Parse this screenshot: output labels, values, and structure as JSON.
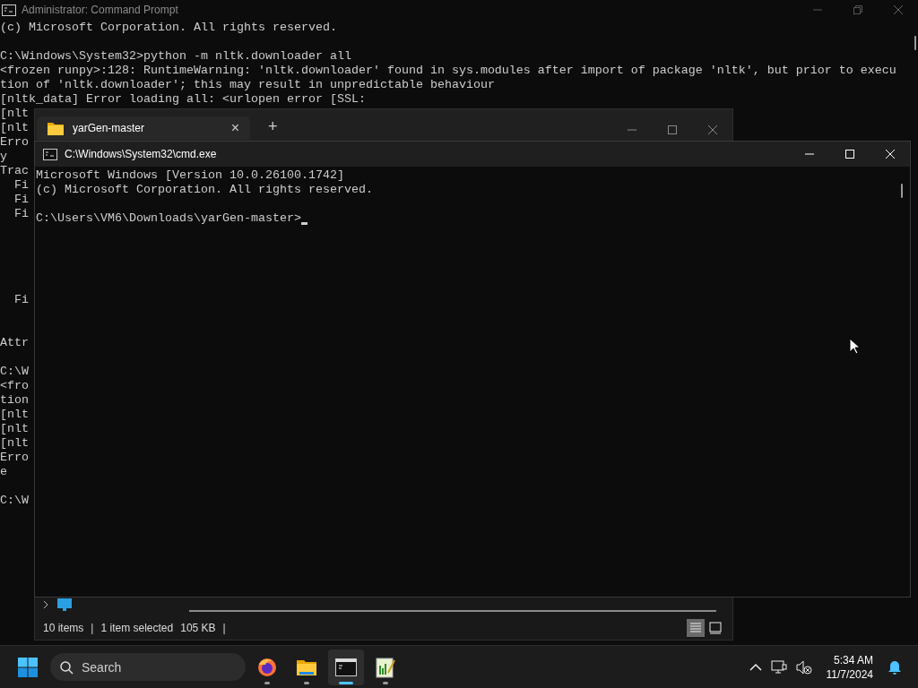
{
  "background_window": {
    "title": "Administrator: Command Prompt",
    "lines": [
      {
        "text": "(c) Microsoft Corporation. All rights reserved.",
        "kind": "text"
      },
      {
        "kind": "blank"
      },
      {
        "text": "C:\\Windows\\System32>python -m nltk.downloader all",
        "kind": "text"
      },
      {
        "text": "<frozen runpy>:128: RuntimeWarning: 'nltk.downloader' found in sys.modules after import of package 'nltk', but prior to execu",
        "kind": "text"
      },
      {
        "text": "tion of 'nltk.downloader'; this may result in unpredictable behaviour",
        "kind": "text"
      },
      {
        "text": "[nltk_data] Error loading all: <urlopen error [SSL:",
        "kind": "text"
      },
      {
        "text": "[nlt",
        "kind": "text"
      },
      {
        "text": "[nlt",
        "kind": "text"
      },
      {
        "text": "Erro",
        "kind": "text"
      },
      {
        "text": "y",
        "kind": "text"
      },
      {
        "text": "Trac",
        "kind": "text"
      },
      {
        "text": "  Fi",
        "kind": "text"
      },
      {
        "text": "  Fi",
        "kind": "text"
      },
      {
        "text": "  Fi",
        "kind": "text"
      },
      {
        "kind": "blank"
      },
      {
        "kind": "blank"
      },
      {
        "kind": "blank"
      },
      {
        "kind": "blank"
      },
      {
        "kind": "blank"
      },
      {
        "text": "  Fi",
        "kind": "text"
      },
      {
        "kind": "blank"
      },
      {
        "kind": "blank"
      },
      {
        "text": "Attr",
        "kind": "text"
      },
      {
        "kind": "blank"
      },
      {
        "text": "C:\\W",
        "kind": "text"
      },
      {
        "text": "<fro",
        "kind": "text"
      },
      {
        "text": "tion",
        "kind": "text"
      },
      {
        "text": "[nlt",
        "kind": "text"
      },
      {
        "text": "[nlt",
        "kind": "text"
      },
      {
        "text": "[nlt",
        "kind": "text"
      },
      {
        "text": "Erro",
        "kind": "text"
      },
      {
        "text": "e",
        "kind": "text"
      },
      {
        "kind": "blank"
      },
      {
        "text": "C:\\W",
        "kind": "text"
      }
    ]
  },
  "explorer_window": {
    "tab": {
      "title": "yarGen-master",
      "close": "×",
      "new_tab": "+"
    },
    "status_bar": {
      "count": "10 items",
      "separator_1": "|",
      "selection": "1 item selected",
      "size": "105 KB",
      "separator_2": "|"
    },
    "view_buttons": [
      {
        "kind": "details",
        "selected": true
      },
      {
        "kind": "tiles",
        "selected": false
      }
    ]
  },
  "cmd_window": {
    "title": "C:\\Windows\\System32\\cmd.exe",
    "lines": [
      {
        "text": "Microsoft Windows [Version 10.0.26100.1742]",
        "kind": "text"
      },
      {
        "text": "(c) Microsoft Corporation. All rights reserved.",
        "kind": "text"
      },
      {
        "kind": "blank"
      },
      {
        "text": "C:\\Users\\VM6\\Downloads\\yarGen-master>",
        "kind": "prompt"
      }
    ]
  },
  "taskbar": {
    "search_placeholder": "Search",
    "apps": [
      {
        "kind": "browser",
        "selected": false
      },
      {
        "kind": "folder",
        "selected": false
      },
      {
        "kind": "terminal",
        "selected": true
      },
      {
        "kind": "notepad",
        "selected": false
      }
    ],
    "time": "5:34 AM",
    "date": "11/7/2024"
  }
}
